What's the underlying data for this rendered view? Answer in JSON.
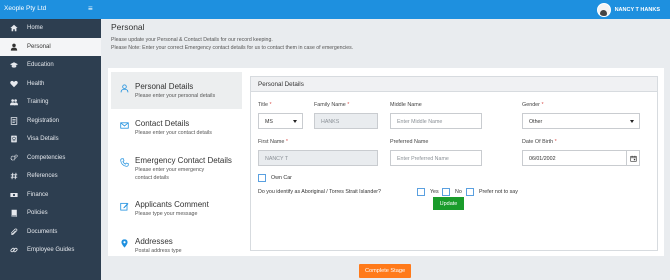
{
  "header": {
    "brand": "Xeople Pty Ltd",
    "menu_glyph": "≡",
    "user_name": "NANCY T HANKS"
  },
  "sidebar": {
    "items": [
      {
        "label": "Home",
        "icon": "home-icon"
      },
      {
        "label": "Personal",
        "icon": "user-icon",
        "active": true
      },
      {
        "label": "Education",
        "icon": "graduation-cap-icon"
      },
      {
        "label": "Health",
        "icon": "heartbeat-icon"
      },
      {
        "label": "Training",
        "icon": "users-icon"
      },
      {
        "label": "Registration",
        "icon": "list-icon"
      },
      {
        "label": "Visa Details",
        "icon": "passport-icon"
      },
      {
        "label": "Competencies",
        "icon": "cogs-icon"
      },
      {
        "label": "References",
        "icon": "hash-icon"
      },
      {
        "label": "Finance",
        "icon": "money-icon"
      },
      {
        "label": "Policies",
        "icon": "book-icon"
      },
      {
        "label": "Documents",
        "icon": "attachment-icon"
      },
      {
        "label": "Employee Guides",
        "icon": "link-icon"
      }
    ]
  },
  "page": {
    "title": "Personal",
    "subtitle_1": "Please update your Personal & Contact Details for our record keeping.",
    "subtitle_2": "Please Note: Enter your correct Emergency contact details for us to contact them in case of emergencies."
  },
  "steps": [
    {
      "title": "Personal Details",
      "desc": "Please enter your personal details",
      "icon": "user-outline-icon",
      "active": true
    },
    {
      "title": "Contact Details",
      "desc": "Please enter your contact details",
      "icon": "envelope-icon"
    },
    {
      "title": "Emergency Contact Details",
      "desc": "Please enter your emergency contact details",
      "icon": "phone-icon"
    },
    {
      "title": "Applicants Comment",
      "desc": "Please type your message",
      "icon": "edit-icon"
    },
    {
      "title": "Addresses",
      "desc": "Postal address type",
      "icon": "map-marker-icon"
    }
  ],
  "form": {
    "heading": "Personal Details",
    "required_mark": "*",
    "title": {
      "label": "Title",
      "value": "MS"
    },
    "family_name": {
      "label": "Family Name",
      "value": "HANKS"
    },
    "middle_name": {
      "label": "Middle Name",
      "placeholder": "Enter Middle Name"
    },
    "gender": {
      "label": "Gender",
      "value": "Other"
    },
    "first_name": {
      "label": "First Name",
      "value": "NANCY T"
    },
    "preferred_name": {
      "label": "Preferred Name",
      "placeholder": "Enter Preferred Name"
    },
    "dob": {
      "label": "Date Of Birth",
      "value": "06/01/2002"
    },
    "own_car": {
      "label": "Own Car",
      "checked": false
    },
    "aboriginal": {
      "question": "Do you identify as Aboriginal / Torres Strait Islander?",
      "options": [
        "Yes",
        "No",
        "Prefer not to say"
      ]
    },
    "update_label": "Update"
  },
  "footer": {
    "complete_label": "Complete Stage"
  },
  "colors": {
    "topbar": "#1e90df",
    "sidebar": "#2d3e50",
    "update_button": "#1a9c2b",
    "complete_button": "#ff7a1a",
    "required": "#d9534f"
  }
}
